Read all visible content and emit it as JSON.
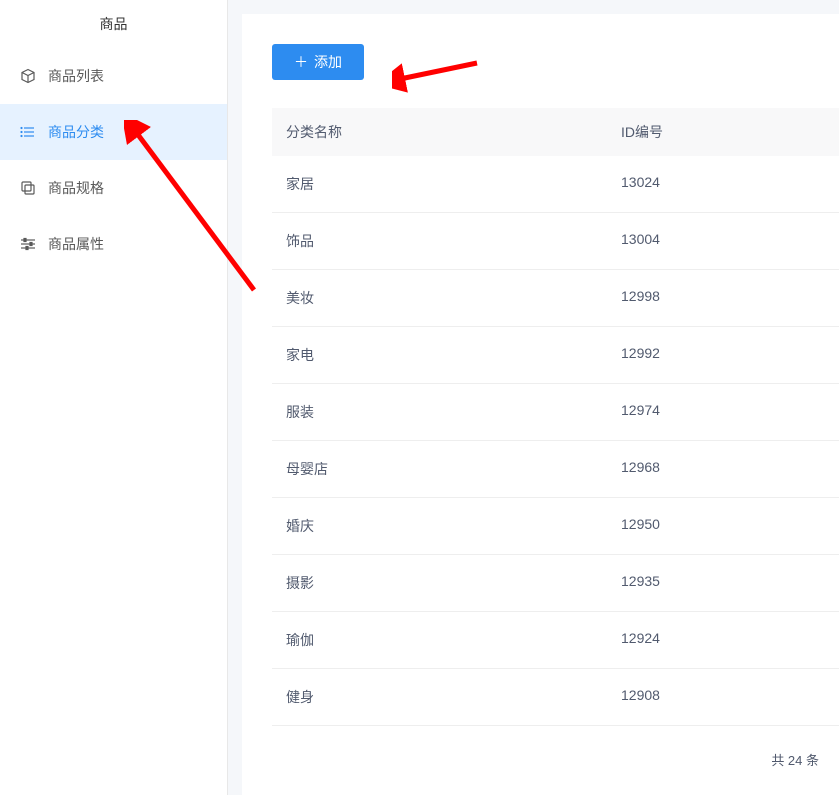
{
  "sidebar": {
    "title": "商品",
    "items": [
      {
        "label": "商品列表"
      },
      {
        "label": "商品分类"
      },
      {
        "label": "商品规格"
      },
      {
        "label": "商品属性"
      }
    ]
  },
  "toolbar": {
    "add_label": "添加"
  },
  "table": {
    "header_name": "分类名称",
    "header_id": "ID编号",
    "rows": [
      {
        "name": "家居",
        "id": "13024"
      },
      {
        "name": "饰品",
        "id": "13004"
      },
      {
        "name": "美妆",
        "id": "12998"
      },
      {
        "name": "家电",
        "id": "12992"
      },
      {
        "name": "服装",
        "id": "12974"
      },
      {
        "name": "母婴店",
        "id": "12968"
      },
      {
        "name": "婚庆",
        "id": "12950"
      },
      {
        "name": "摄影",
        "id": "12935"
      },
      {
        "name": "瑜伽",
        "id": "12924"
      },
      {
        "name": "健身",
        "id": "12908"
      }
    ]
  },
  "pagination": {
    "total_text": "共 24 条"
  }
}
